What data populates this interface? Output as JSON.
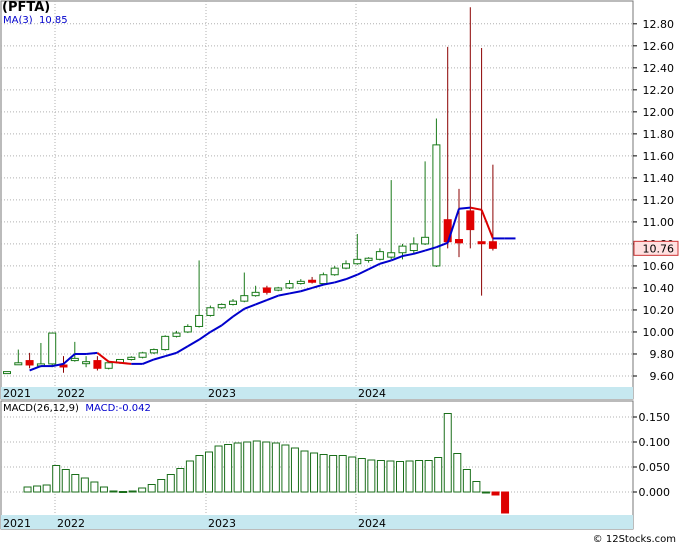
{
  "header": {
    "ticker": "(PFTA)",
    "ma_label": "MA(3)",
    "ma_value": "10.85",
    "macd_label": "MACD(26,12,9)",
    "macd_value_label": "MACD:-0.042"
  },
  "footer": {
    "credit": "© 12Stocks.com"
  },
  "colors": {
    "up_candle": "#1a7a1a",
    "down_candle": "#e00000",
    "ma_up": "#0000cc",
    "ma_down": "#dd0000",
    "macd_bar": "#1a6e1a",
    "macd_negative": "#dd0000",
    "axis_band": "#c6e8f0",
    "last_price_box": "#ffe0e0",
    "grid": "#b0b0b0"
  },
  "chart_data": [
    {
      "type": "candlestick",
      "title": "(PFTA)",
      "ylim": [
        9.5,
        13.0
      ],
      "yticks": [
        9.6,
        9.8,
        10.0,
        10.2,
        10.4,
        10.6,
        10.8,
        11.0,
        11.2,
        11.4,
        11.6,
        11.8,
        12.0,
        12.2,
        12.4,
        12.6,
        12.8
      ],
      "year_labels": [
        "2021",
        "2022",
        "2023",
        "2024"
      ],
      "last_price": "10.76",
      "grid": true,
      "candles": [
        {
          "o": 9.63,
          "h": 9.64,
          "l": 9.62,
          "c": 9.64,
          "year": "2021"
        },
        {
          "o": 9.72,
          "h": 9.84,
          "l": 9.7,
          "c": 9.72
        },
        {
          "o": 9.74,
          "h": 9.81,
          "l": 9.67,
          "c": 9.7,
          "year": "2022"
        },
        {
          "o": 9.7,
          "h": 9.9,
          "l": 9.68,
          "c": 9.71
        },
        {
          "o": 9.71,
          "h": 9.95,
          "l": 9.68,
          "c": 9.99
        },
        {
          "o": 9.7,
          "h": 9.78,
          "l": 9.63,
          "c": 9.69
        },
        {
          "o": 9.74,
          "h": 9.91,
          "l": 9.73,
          "c": 9.76
        },
        {
          "o": 9.72,
          "h": 9.78,
          "l": 9.68,
          "c": 9.73
        },
        {
          "o": 9.74,
          "h": 9.78,
          "l": 9.65,
          "c": 9.67
        },
        {
          "o": 9.67,
          "h": 9.73,
          "l": 9.66,
          "c": 9.72
        },
        {
          "o": 9.72,
          "h": 9.75,
          "l": 9.71,
          "c": 9.75
        },
        {
          "o": 9.75,
          "h": 9.78,
          "l": 9.74,
          "c": 9.77
        },
        {
          "o": 9.77,
          "h": 9.82,
          "l": 9.76,
          "c": 9.81
        },
        {
          "o": 9.81,
          "h": 9.85,
          "l": 9.8,
          "c": 9.84
        },
        {
          "o": 9.84,
          "h": 9.97,
          "l": 9.83,
          "c": 9.96
        },
        {
          "o": 9.96,
          "h": 10.01,
          "l": 9.95,
          "c": 9.99
        },
        {
          "o": 10.0,
          "h": 10.07,
          "l": 9.99,
          "c": 10.05,
          "year": "2023"
        },
        {
          "o": 10.05,
          "h": 10.65,
          "l": 10.04,
          "c": 10.15
        },
        {
          "o": 10.15,
          "h": 10.24,
          "l": 10.14,
          "c": 10.22
        },
        {
          "o": 10.22,
          "h": 10.26,
          "l": 10.21,
          "c": 10.25
        },
        {
          "o": 10.25,
          "h": 10.3,
          "l": 10.24,
          "c": 10.28
        },
        {
          "o": 10.28,
          "h": 10.54,
          "l": 10.27,
          "c": 10.33
        },
        {
          "o": 10.33,
          "h": 10.42,
          "l": 10.32,
          "c": 10.36
        },
        {
          "o": 10.4,
          "h": 10.42,
          "l": 10.34,
          "c": 10.36
        },
        {
          "o": 10.38,
          "h": 10.41,
          "l": 10.37,
          "c": 10.4
        },
        {
          "o": 10.4,
          "h": 10.47,
          "l": 10.39,
          "c": 10.44
        },
        {
          "o": 10.44,
          "h": 10.48,
          "l": 10.43,
          "c": 10.46
        },
        {
          "o": 10.47,
          "h": 10.5,
          "l": 10.44,
          "c": 10.46
        },
        {
          "o": 10.44,
          "h": 10.54,
          "l": 10.43,
          "c": 10.52
        },
        {
          "o": 10.52,
          "h": 10.6,
          "l": 10.51,
          "c": 10.58
        },
        {
          "o": 10.58,
          "h": 10.65,
          "l": 10.57,
          "c": 10.62,
          "year": "2024"
        },
        {
          "o": 10.62,
          "h": 10.89,
          "l": 10.61,
          "c": 10.66
        },
        {
          "o": 10.65,
          "h": 10.68,
          "l": 10.63,
          "c": 10.67
        },
        {
          "o": 10.66,
          "h": 10.76,
          "l": 10.65,
          "c": 10.73
        },
        {
          "o": 10.68,
          "h": 11.38,
          "l": 10.66,
          "c": 10.72
        },
        {
          "o": 10.72,
          "h": 10.8,
          "l": 10.66,
          "c": 10.78
        },
        {
          "o": 10.74,
          "h": 10.86,
          "l": 10.71,
          "c": 10.8
        },
        {
          "o": 10.8,
          "h": 11.55,
          "l": 10.79,
          "c": 10.86
        },
        {
          "o": 10.6,
          "h": 11.94,
          "l": 10.59,
          "c": 11.7
        },
        {
          "o": 11.02,
          "h": 12.59,
          "l": 10.76,
          "c": 10.82
        },
        {
          "o": 10.84,
          "h": 11.3,
          "l": 10.68,
          "c": 10.81
        },
        {
          "o": 11.1,
          "h": 12.95,
          "l": 10.76,
          "c": 10.93
        },
        {
          "o": 10.82,
          "h": 12.58,
          "l": 10.33,
          "c": 10.81
        },
        {
          "o": 10.82,
          "h": 11.52,
          "l": 10.74,
          "c": 10.76
        }
      ],
      "ma3": [
        9.65,
        9.69,
        9.69,
        9.71,
        9.8,
        9.8,
        9.81,
        9.73,
        9.72,
        9.71,
        9.71,
        9.75,
        9.78,
        9.81,
        9.87,
        9.93,
        10.0,
        10.06,
        10.14,
        10.21,
        10.25,
        10.29,
        10.33,
        10.35,
        10.37,
        10.4,
        10.43,
        10.45,
        10.48,
        10.52,
        10.57,
        10.62,
        10.65,
        10.69,
        10.71,
        10.74,
        10.77,
        10.81,
        11.12,
        11.13,
        11.11,
        10.85,
        10.85,
        10.85
      ]
    },
    {
      "type": "bar",
      "title": "MACD(26,12,9)",
      "ylim": [
        -0.032,
        0.165
      ],
      "yticks": [
        0.0,
        0.05,
        0.1,
        0.15
      ],
      "year_labels": [
        "2021",
        "2022",
        "2023",
        "2024"
      ],
      "values": [
        null,
        0.01,
        0.012,
        0.014,
        0.053,
        0.045,
        0.035,
        0.028,
        0.02,
        0.01,
        0.002,
        0.001,
        0.002,
        0.008,
        0.015,
        0.025,
        0.035,
        0.047,
        0.062,
        0.073,
        0.08,
        0.092,
        0.095,
        0.098,
        0.1,
        0.102,
        0.1,
        0.098,
        0.094,
        0.088,
        0.082,
        0.078,
        0.075,
        0.073,
        0.073,
        0.07,
        0.067,
        0.064,
        0.063,
        0.062,
        0.061,
        0.062,
        0.063,
        0.063,
        0.069,
        0.157,
        0.077,
        0.045,
        0.021,
        0.0,
        -0.006,
        -0.042
      ]
    }
  ]
}
